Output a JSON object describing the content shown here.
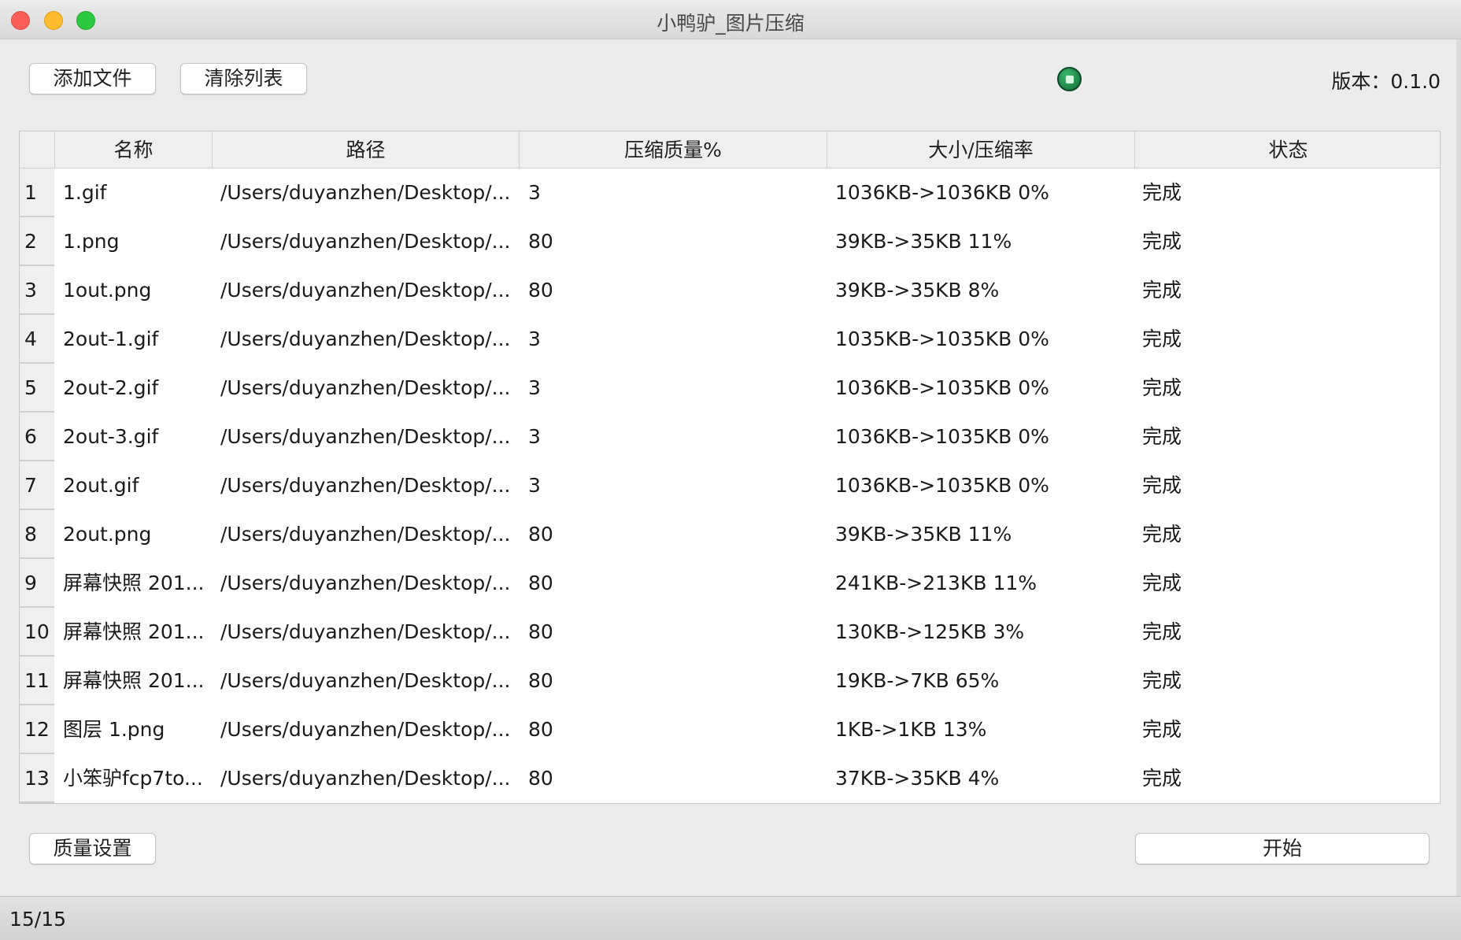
{
  "window": {
    "title": "小鸭驴_图片压缩"
  },
  "toolbar": {
    "add_files_label": "添加文件",
    "clear_list_label": "清除列表",
    "version_label": "版本：0.1.0"
  },
  "table": {
    "headers": [
      "名称",
      "路径",
      "压缩质量%",
      "大小/压缩率",
      "状态"
    ],
    "rows": [
      {
        "num": "1",
        "name": "1.gif",
        "path": "/Users/duyanzhen/Desktop/...",
        "quality": "3",
        "size": "1036KB->1036KB  0%",
        "status": "完成"
      },
      {
        "num": "2",
        "name": "1.png",
        "path": "/Users/duyanzhen/Desktop/...",
        "quality": "80",
        "size": "39KB->35KB  11%",
        "status": "完成"
      },
      {
        "num": "3",
        "name": "1out.png",
        "path": "/Users/duyanzhen/Desktop/...",
        "quality": "80",
        "size": "39KB->35KB  8%",
        "status": "完成"
      },
      {
        "num": "4",
        "name": "2out-1.gif",
        "path": "/Users/duyanzhen/Desktop/...",
        "quality": "3",
        "size": "1035KB->1035KB  0%",
        "status": "完成"
      },
      {
        "num": "5",
        "name": "2out-2.gif",
        "path": "/Users/duyanzhen/Desktop/...",
        "quality": "3",
        "size": "1036KB->1035KB  0%",
        "status": "完成"
      },
      {
        "num": "6",
        "name": "2out-3.gif",
        "path": "/Users/duyanzhen/Desktop/...",
        "quality": "3",
        "size": "1036KB->1035KB  0%",
        "status": "完成"
      },
      {
        "num": "7",
        "name": "2out.gif",
        "path": "/Users/duyanzhen/Desktop/...",
        "quality": "3",
        "size": "1036KB->1035KB  0%",
        "status": "完成"
      },
      {
        "num": "8",
        "name": "2out.png",
        "path": "/Users/duyanzhen/Desktop/...",
        "quality": "80",
        "size": "39KB->35KB  11%",
        "status": "完成"
      },
      {
        "num": "9",
        "name": "屏幕快照 201...",
        "path": "/Users/duyanzhen/Desktop/...",
        "quality": "80",
        "size": "241KB->213KB  11%",
        "status": "完成"
      },
      {
        "num": "10",
        "name": "屏幕快照 201...",
        "path": "/Users/duyanzhen/Desktop/...",
        "quality": "80",
        "size": "130KB->125KB  3%",
        "status": "完成"
      },
      {
        "num": "11",
        "name": "屏幕快照 201...",
        "path": "/Users/duyanzhen/Desktop/...",
        "quality": "80",
        "size": "19KB->7KB  65%",
        "status": "完成"
      },
      {
        "num": "12",
        "name": "图层 1.png",
        "path": "/Users/duyanzhen/Desktop/...",
        "quality": "80",
        "size": "1KB->1KB  13%",
        "status": "完成"
      },
      {
        "num": "13",
        "name": "小笨驴fcp7to...",
        "path": "/Users/duyanzhen/Desktop/...",
        "quality": "80",
        "size": "37KB->35KB  4%",
        "status": "完成"
      }
    ]
  },
  "footer": {
    "quality_settings_label": "质量设置",
    "start_label": "开始"
  },
  "statusbar": {
    "progress": "15/15"
  },
  "icons": {
    "status_indicator": "green-circle-icon"
  },
  "colors": {
    "close": "#fc5f57",
    "minimize": "#fdbb2e",
    "maximize": "#2ac940",
    "indicator": "#1a8a4a"
  }
}
